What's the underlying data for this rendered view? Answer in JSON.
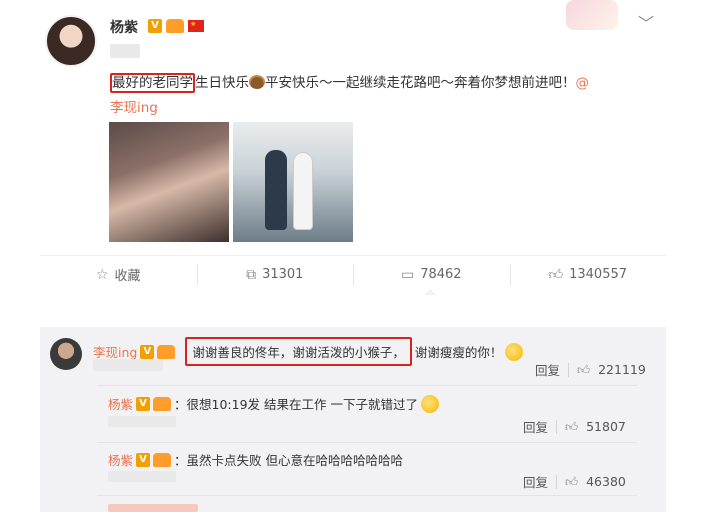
{
  "post": {
    "author": "杨紫",
    "text_highlight": "最好的老同学",
    "text_rest": "生日快乐",
    "text_after_cake": "平安快乐～一起继续走花路吧～奔着你梦想前进吧！",
    "mention_at": "@",
    "mention_name": "李现ing"
  },
  "actions": {
    "favorite_label": "收藏",
    "repost_count": "31301",
    "comment_count": "78462",
    "like_count": "1340557"
  },
  "comment": {
    "author": "李现ing",
    "text_highlight": "谢谢善良的佟年，谢谢活泼的小猴子，",
    "text_rest": "谢谢瘦瘦的你！",
    "reply_label": "回复",
    "like_count": "221119"
  },
  "replies": [
    {
      "author": "杨紫",
      "text": "：很想10:19发 结果在工作 一下子就错过了",
      "reply_label": "回复",
      "like_count": "51807"
    },
    {
      "author": "杨紫",
      "text": "：虽然卡点失败 但心意在哈哈哈哈哈哈哈",
      "reply_label": "回复",
      "like_count": "46380"
    }
  ],
  "colors": {
    "accent": "#eb7350",
    "highlight_box": "#d9231d",
    "comment_bg": "#f2f2f5"
  }
}
